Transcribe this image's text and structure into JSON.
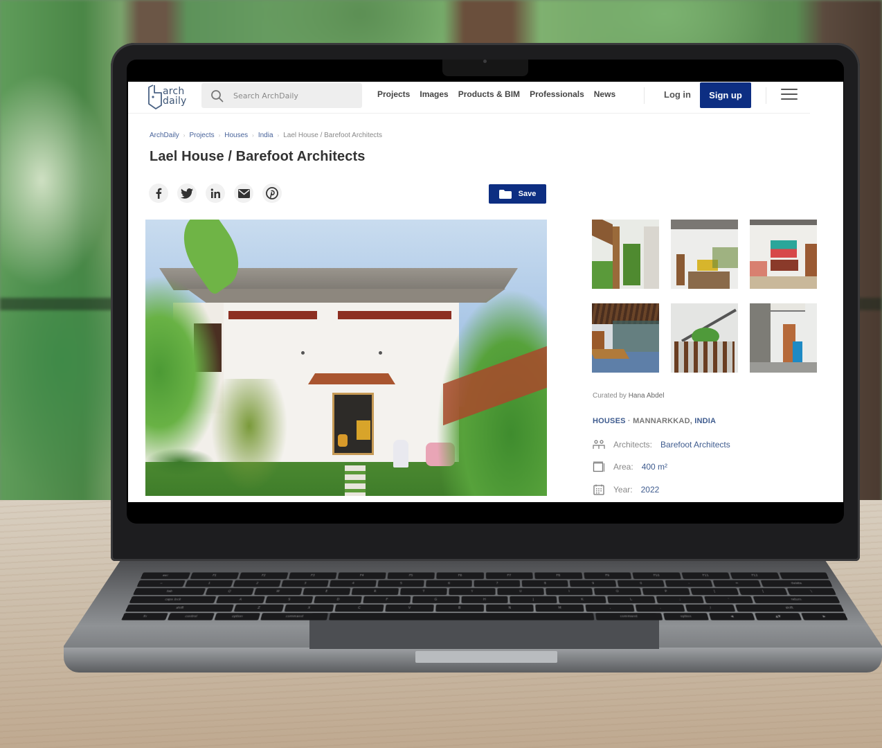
{
  "site": {
    "logo_line1": "arch",
    "logo_line2": "daily",
    "search_placeholder": "Search ArchDaily",
    "nav": [
      "Projects",
      "Images",
      "Products & BIM",
      "Professionals",
      "News"
    ],
    "login_label": "Log in",
    "signup_label": "Sign up",
    "menu_icon": "hamburger-icon",
    "accent_color": "#0d2e82"
  },
  "breadcrumb": [
    {
      "label": "ArchDaily",
      "link": true
    },
    {
      "label": "Projects",
      "link": true
    },
    {
      "label": "Houses",
      "link": true
    },
    {
      "label": "India",
      "link": true
    },
    {
      "label": "Lael House / Barefoot Architects",
      "link": false
    }
  ],
  "article": {
    "title": "Lael House / Barefoot Architects",
    "share_icons": [
      "facebook-icon",
      "twitter-icon",
      "linkedin-icon",
      "email-icon",
      "pinterest-icon"
    ],
    "save_label": "Save",
    "hero_image_alt": "White house facade with cantilevered concrete roof, garden and stepping stones",
    "thumbnails": [
      "Veranda with timber frame and courtyard garden",
      "Double-height living room with yellow sofa",
      "Living room with teal and red painting",
      "Timber roof hall with reflecting floor",
      "Dining area with staircase and plants",
      "Corridor with blue cabinet and wooden door"
    ]
  },
  "sidebar": {
    "curated_prefix": "Curated by",
    "curator": "Hana Abdel",
    "category": "HOUSES",
    "separator": "·",
    "location_city": "MANNARKKAD,",
    "location_country": "INDIA",
    "specs": [
      {
        "icon": "architects-icon",
        "label": "Architects:",
        "value": "Barefoot Architects",
        "link": true
      },
      {
        "icon": "area-icon",
        "label": "Area:",
        "value": "400 m²",
        "link": false
      },
      {
        "icon": "calendar-icon",
        "label": "Year:",
        "value": "2022",
        "link": true
      }
    ]
  },
  "keyboard": {
    "row1": [
      "esc",
      "F1",
      "F2",
      "F3",
      "F4",
      "F5",
      "F6",
      "F7",
      "F8",
      "F9",
      "F10",
      "F11",
      "F12",
      ""
    ],
    "row2": [
      "~",
      "1",
      "2",
      "3",
      "4",
      "5",
      "6",
      "7",
      "8",
      "9",
      "0",
      "-",
      "=",
      "delete"
    ],
    "row3": [
      "tab",
      "Q",
      "W",
      "E",
      "R",
      "T",
      "Y",
      "U",
      "I",
      "O",
      "P",
      "[",
      "]",
      "\\"
    ],
    "row4": [
      "caps lock",
      "A",
      "S",
      "D",
      "F",
      "G",
      "H",
      "J",
      "K",
      "L",
      ";",
      "'",
      "return"
    ],
    "row5": [
      "shift",
      "Z",
      "X",
      "C",
      "V",
      "B",
      "N",
      "M",
      ",",
      ".",
      "/",
      "shift"
    ],
    "row6": [
      "fn",
      "control",
      "option",
      "command",
      "",
      "command",
      "option",
      "◀",
      "▲▼",
      "▶"
    ]
  }
}
